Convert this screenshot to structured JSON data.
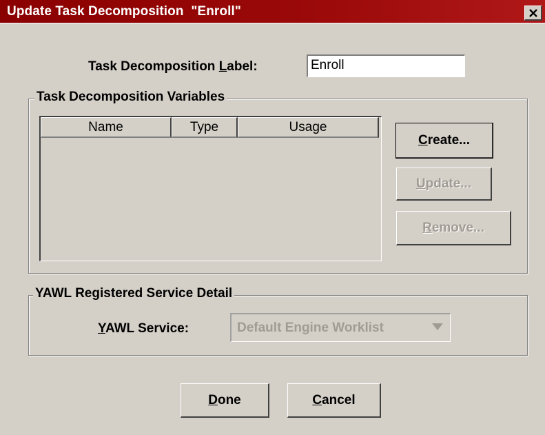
{
  "window": {
    "title": "Update Task Decomposition  \"Enroll\"",
    "close_icon": "close-icon"
  },
  "label_field": {
    "label_prefix": "Task Decomposition ",
    "label_mnemonic": "L",
    "label_suffix": "abel:",
    "value": "Enroll"
  },
  "variables_group": {
    "title": "Task Decomposition Variables",
    "columns": [
      "Name",
      "Type",
      "Usage"
    ],
    "rows": []
  },
  "variable_buttons": {
    "create": {
      "mnemonic": "C",
      "rest": "reate...",
      "enabled": true
    },
    "update": {
      "mnemonic": "U",
      "rest": "pdate...",
      "enabled": false
    },
    "remove": {
      "mnemonic": "R",
      "rest": "emove...",
      "enabled": false
    }
  },
  "service_group": {
    "title": "YAWL Registered Service Detail",
    "service_label_mnemonic": "Y",
    "service_label_rest": "AWL Service:",
    "service_value": "Default Engine Worklist"
  },
  "footer_buttons": {
    "done": {
      "mnemonic": "D",
      "rest": "one"
    },
    "cancel": {
      "mnemonic": "C",
      "rest": "ancel"
    }
  }
}
